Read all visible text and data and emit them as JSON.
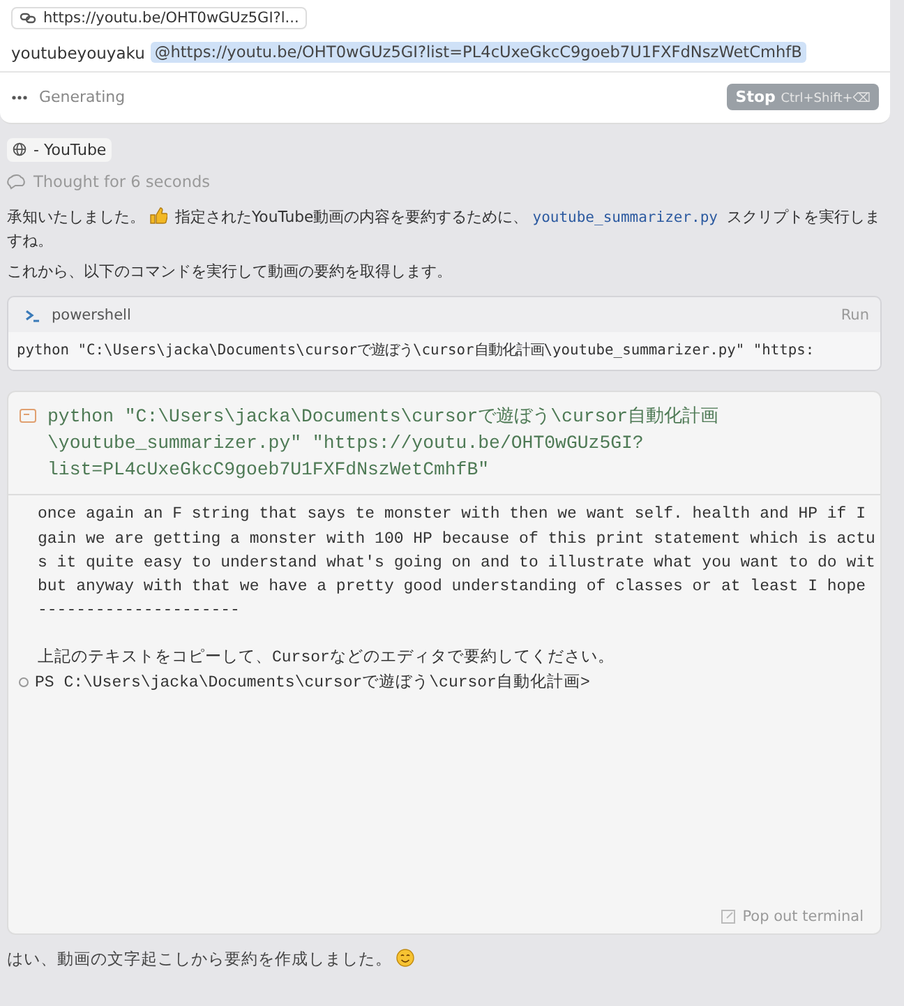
{
  "composer": {
    "context_chip": "https://youtu.be/OHT0wGUz5GI?l...",
    "prompt_text": "youtubeyouyaku",
    "mention": "@https://youtu.be/OHT0wGUz5GI?list=PL4cUxeGkcC9goeb7U1FXFdNszWetCmhfB",
    "status": "Generating",
    "stop_button": {
      "label": "Stop",
      "shortcut": "Ctrl+Shift+⌫"
    }
  },
  "source_chip": "- YouTube",
  "thought": "Thought for 6 seconds",
  "message": {
    "before": "承知いたしました。",
    "after_emoji": " 指定されたYouTube動画の内容を要約するために、",
    "code": "youtube_summarizer.py",
    "after_code": " スクリプトを実行しますね。"
  },
  "paragraph": "これから、以下のコマンドを実行して動画の要約を取得します。",
  "code_block": {
    "language": "powershell",
    "run_label": "Run",
    "command": "python \"C:\\Users\\jacka\\Documents\\cursorで遊ぼう\\cursor自動化計画\\youtube_summarizer.py\" \"https:"
  },
  "terminal": {
    "command_lines": [
      "python \"C:\\Users\\jacka\\Documents\\cursorで遊ぼう\\cursor自動化計画",
      "\\youtube_summarizer.py\" \"https://youtu.be/OHT0wGUz5GI?",
      "list=PL4cUxeGkcC9goeb7U1FXFdNszWetCmhfB\""
    ],
    "output_lines": [
      "once again an F string that says te monster with then we want self. health and HP if I",
      "gain we are getting a monster with 100 HP because of this print statement which is actu",
      "s it quite easy to understand what's going on and to illustrate what you want to do wit",
      "but anyway with that we have a pretty good understanding of classes or at least I hope",
      "---------------------"
    ],
    "note": "上記のテキストをコピーして、Cursorなどのエディタで要約してください。",
    "prompt": "PS C:\\Users\\jacka\\Documents\\cursorで遊ぼう\\cursor自動化計画>",
    "pop_out": "Pop out terminal"
  },
  "final_message": "はい、動画の文字起こしから要約を作成しました。"
}
